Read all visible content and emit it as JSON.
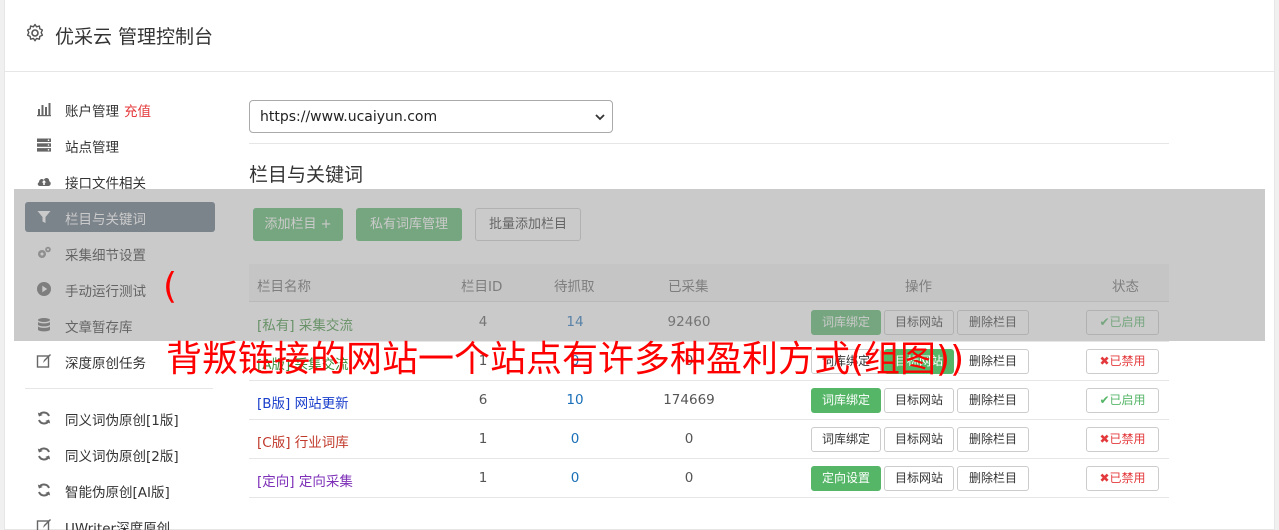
{
  "header": {
    "title": "优采云 管理控制台"
  },
  "sidebar": {
    "items": [
      {
        "label": "账户管理",
        "tag": "充值"
      },
      {
        "label": "站点管理"
      },
      {
        "label": "接口文件相关"
      },
      {
        "label": "栏目与关键词"
      },
      {
        "label": "采集细节设置"
      },
      {
        "label": "手动运行测试"
      },
      {
        "label": "文章暂存库"
      },
      {
        "label": "深度原创任务"
      }
    ],
    "items2": [
      {
        "label": "同义词伪原创[1版]"
      },
      {
        "label": "同义词伪原创[2版]"
      },
      {
        "label": "智能伪原创[AI版]"
      },
      {
        "label": "UWriter深度原创"
      }
    ]
  },
  "main": {
    "site_select": "https://www.ucaiyun.com",
    "section_title": "栏目与关键词",
    "buttons": {
      "add": "添加栏目 +",
      "private": "私有词库管理",
      "batch": "批量添加栏目"
    },
    "table": {
      "headers": [
        "栏目名称",
        "栏目ID",
        "待抓取",
        "已采集",
        "操作",
        "状态"
      ],
      "rows": [
        {
          "name": "[私有] 采集交流",
          "color": "#3c8f3c",
          "id": "4",
          "pending": "14",
          "collected": "92460",
          "op1": "词库绑定",
          "op1_green": true,
          "op2": "目标网站",
          "op2_green": false,
          "op3": "删除栏目",
          "status": "✔已启用",
          "on": true
        },
        {
          "name": "[A版] 采集交流",
          "color": "#3c8f3c",
          "id": "1",
          "pending": "0",
          "collected": "0",
          "op1": "词库绑定",
          "op1_green": false,
          "op2": "目标网站",
          "op2_green": true,
          "op3": "删除栏目",
          "status": "✖已禁用",
          "on": false
        },
        {
          "name": "[B版] 网站更新",
          "color": "#1a3fcc",
          "id": "6",
          "pending": "10",
          "collected": "174669",
          "op1": "词库绑定",
          "op1_green": true,
          "op2": "目标网站",
          "op2_green": false,
          "op3": "删除栏目",
          "status": "✔已启用",
          "on": true
        },
        {
          "name": "[C版] 行业词库",
          "color": "#c0392b",
          "id": "1",
          "pending": "0",
          "collected": "0",
          "op1": "词库绑定",
          "op1_green": false,
          "op2": "目标网站",
          "op2_green": false,
          "op3": "删除栏目",
          "status": "✖已禁用",
          "on": false
        },
        {
          "name": "[定向] 定向采集",
          "color": "#7d2fb8",
          "id": "1",
          "pending": "0",
          "collected": "0",
          "op1": "定向设置",
          "op1_green": true,
          "op2": "目标网站",
          "op2_green": false,
          "op3": "删除栏目",
          "status": "✖已禁用",
          "on": false
        }
      ]
    }
  },
  "overlay": {
    "line1": "(",
    "line2": "背叛链接的网站一个站点有许多种盈利方式(组图))"
  },
  "colors": {
    "accent": "#56b668",
    "active_nav": "#607080",
    "danger": "#e4393c",
    "overlay_text": "#ff0000"
  }
}
